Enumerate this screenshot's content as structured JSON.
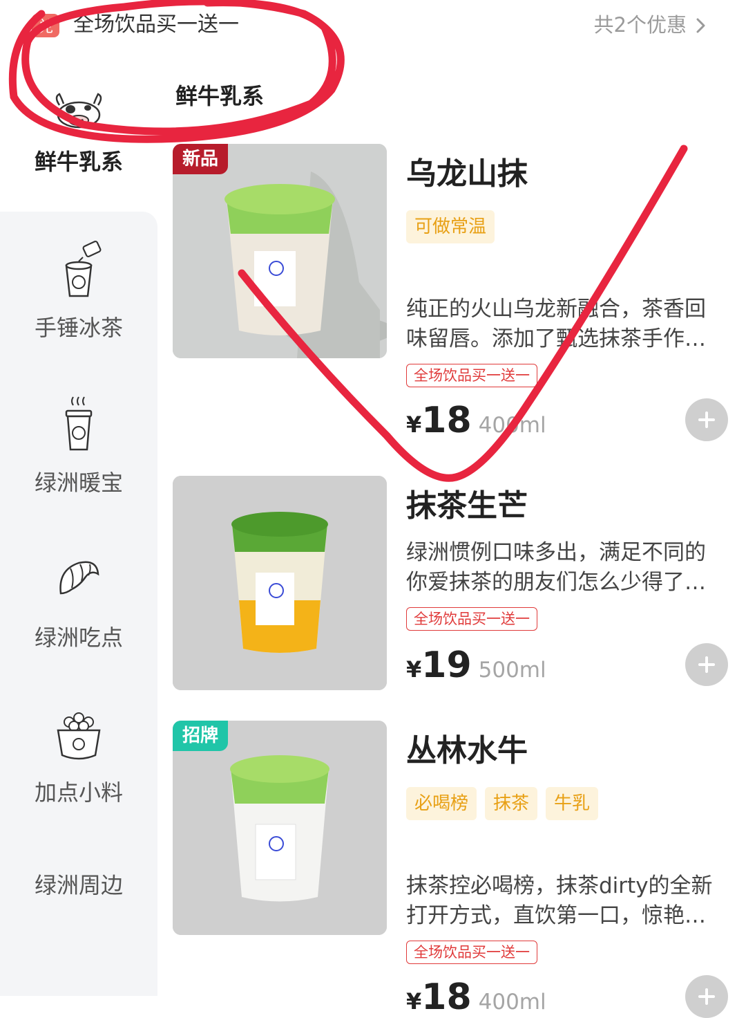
{
  "promo": {
    "badge": "兑",
    "text": "全场饮品买一送一",
    "count": "共2个优惠"
  },
  "section_header": "鲜牛乳系",
  "sidebar": {
    "items": [
      {
        "label": "鲜牛乳系",
        "icon": "cow-icon",
        "active": true
      },
      {
        "label": "手锤冰茶",
        "icon": "iced-tea-icon"
      },
      {
        "label": "绿洲暖宝",
        "icon": "hot-drink-icon"
      },
      {
        "label": "绿洲吃点",
        "icon": "croissant-icon"
      },
      {
        "label": "加点小料",
        "icon": "toppings-bowl-icon"
      },
      {
        "label": "绿洲周边",
        "icon": ""
      }
    ]
  },
  "products": [
    {
      "tag": "新品",
      "name": "乌龙山抹",
      "attrs": [
        "可做常温"
      ],
      "desc": "纯正的火山乌龙新融合，茶香回味留唇。添加了甄选抹茶手作…",
      "promo": "全场饮品买一送一",
      "currency": "¥",
      "price": "18",
      "volume": "400ml"
    },
    {
      "tag": "",
      "name": "抹茶生芒",
      "attrs": [],
      "desc": "绿洲惯例口味多出，满足不同的你爱抹茶的朋友们怎么少得了…",
      "promo": "全场饮品买一送一",
      "currency": "¥",
      "price": "19",
      "volume": "500ml"
    },
    {
      "tag": "招牌",
      "name": "丛林水牛",
      "attrs": [
        "必喝榜",
        "抹茶",
        "牛乳"
      ],
      "desc": "抹茶控必喝榜，抹茶dirty的全新打开方式，直饮第一口，惊艳…",
      "promo": "全场饮品买一送一",
      "currency": "¥",
      "price": "18",
      "volume": "400ml"
    }
  ],
  "colors": {
    "accent_red": "#e03a3a",
    "tag_new": "#b71c2b",
    "tag_signature": "#20c5a8",
    "attr_bg": "#fdf3dc",
    "attr_text": "#e8a015",
    "annotation": "#e8253f"
  }
}
